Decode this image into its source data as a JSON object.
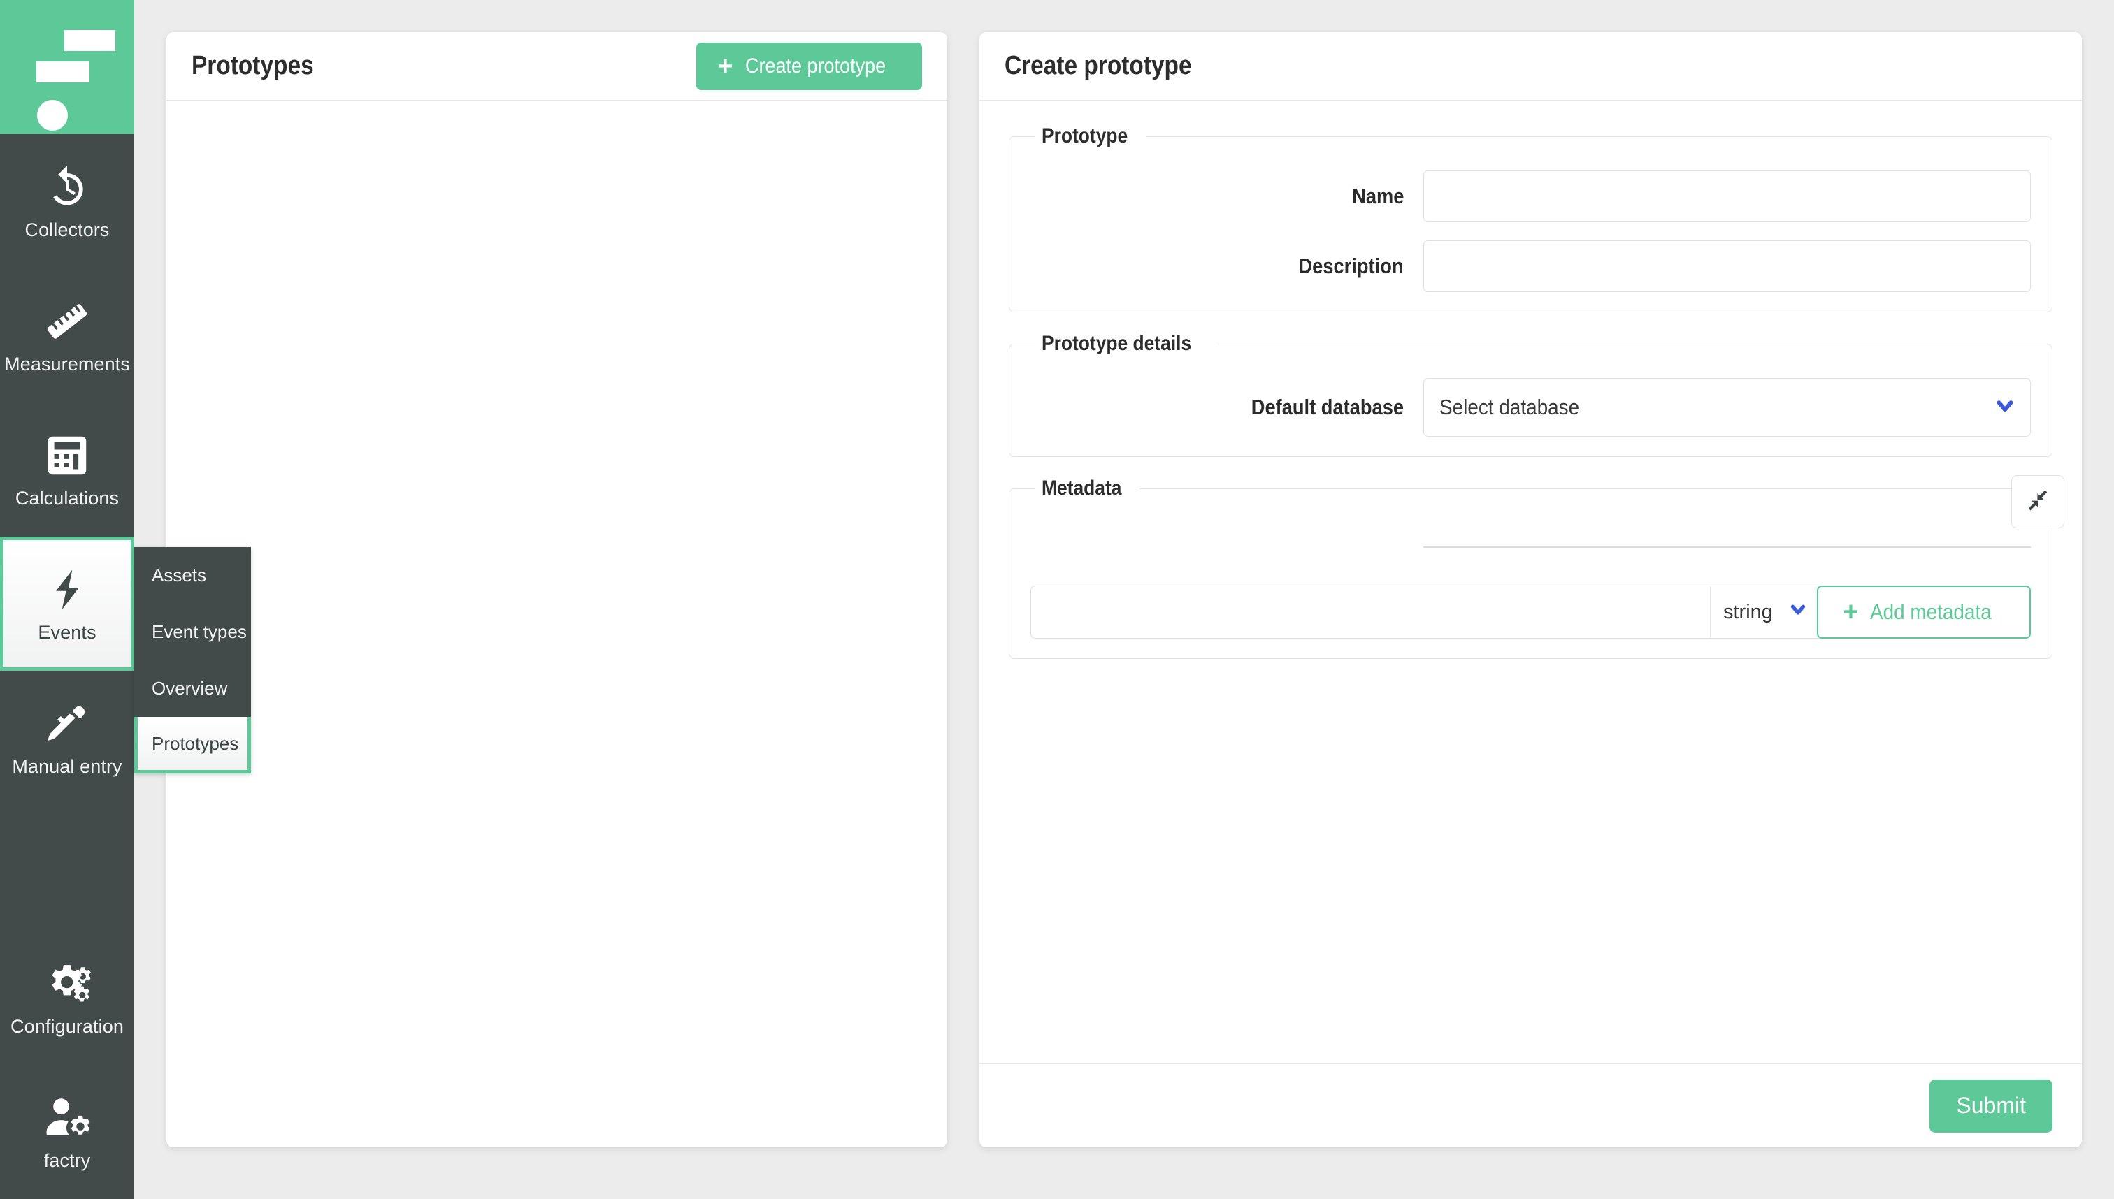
{
  "theme": {
    "accent_green": "#5ec998",
    "sidebar_dark": "#424a4a",
    "page_bg": "#ececec",
    "dropdown_chevron_blue": "#3b5bdb"
  },
  "sidebar": {
    "logo_name": "factry-logo",
    "items": [
      {
        "label": "Collectors",
        "icon": "history-clock-icon",
        "active": false
      },
      {
        "label": "Measurements",
        "icon": "ruler-icon",
        "active": false
      },
      {
        "label": "Calculations",
        "icon": "calculator-icon",
        "active": false
      },
      {
        "label": "Events",
        "icon": "lightning-bolt-icon",
        "active": true
      },
      {
        "label": "Manual entry",
        "icon": "pen-icon",
        "active": false
      }
    ],
    "bottom_items": [
      {
        "label": "Configuration",
        "icon": "gears-icon",
        "active": false
      },
      {
        "label": "factry",
        "icon": "user-gear-icon",
        "active": false
      }
    ],
    "submenu": {
      "items": [
        {
          "label": "Assets",
          "active": false
        },
        {
          "label": "Event types",
          "active": false
        },
        {
          "label": "Overview",
          "active": false
        },
        {
          "label": "Prototypes",
          "active": true
        }
      ]
    }
  },
  "left_panel": {
    "title": "Prototypes",
    "create_button": {
      "label": "Create prototype",
      "icon": "plus-icon"
    },
    "body_items": []
  },
  "right_panel": {
    "title": "Create prototype",
    "groups": {
      "prototype": {
        "legend": "Prototype",
        "fields": [
          {
            "label": "Name",
            "value": "",
            "placeholder": ""
          },
          {
            "label": "Description",
            "value": "",
            "placeholder": ""
          }
        ]
      },
      "prototype_details": {
        "legend": "Prototype details",
        "default_database": {
          "label": "Default database",
          "selected": "Select database",
          "chevron_icon": "chevron-down-icon"
        }
      },
      "metadata": {
        "legend": "Metadata",
        "collapse_icon": "compress-arrows-icon",
        "key_input": {
          "value": "",
          "placeholder": ""
        },
        "type_select": {
          "selected": "string",
          "chevron_icon": "chevron-down-icon"
        },
        "add_button": {
          "label": "Add metadata",
          "icon": "plus-icon"
        }
      }
    },
    "submit_button": {
      "label": "Submit"
    }
  }
}
